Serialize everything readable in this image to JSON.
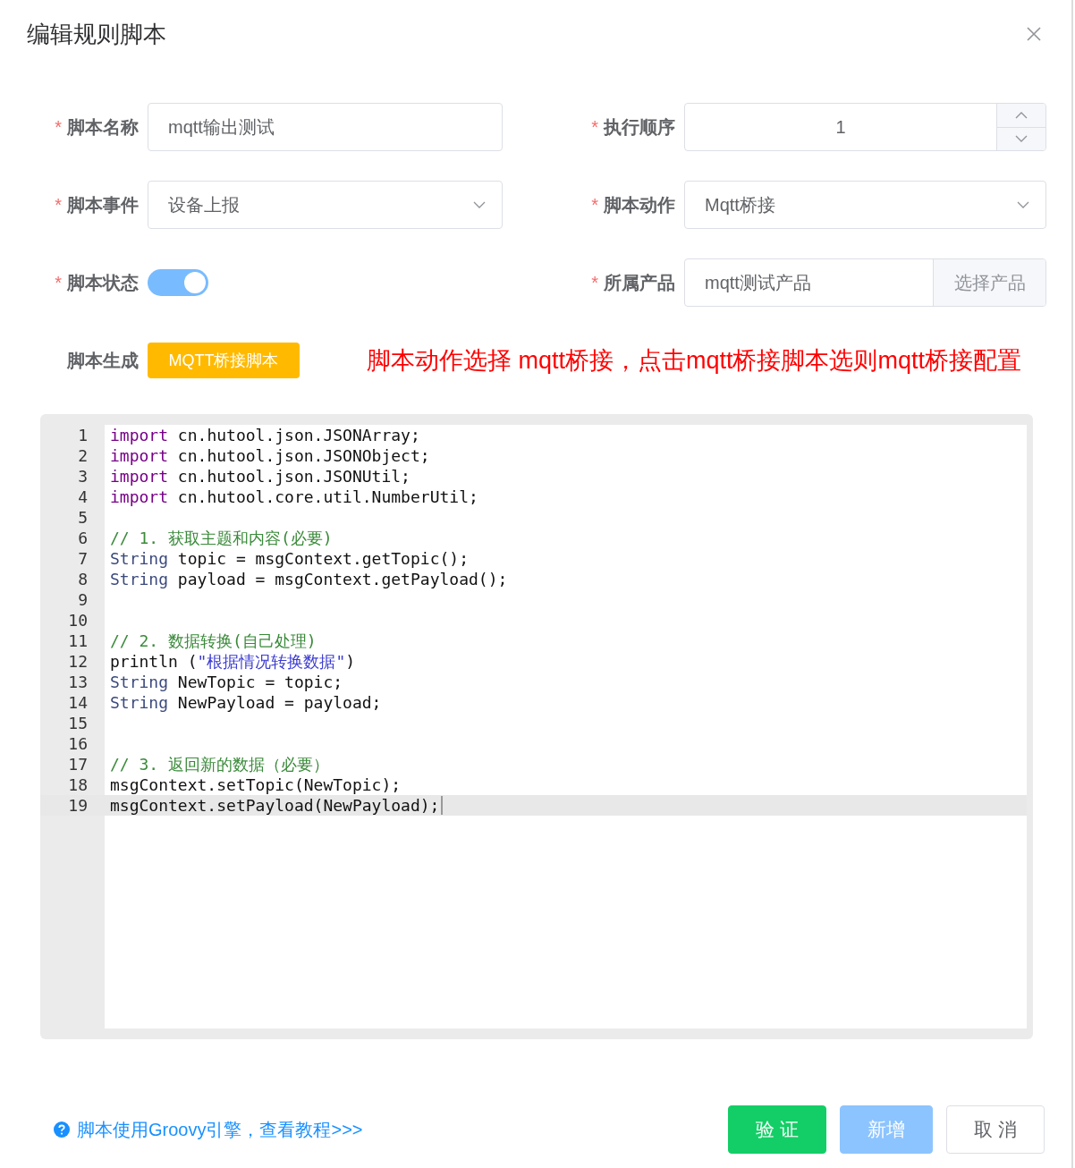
{
  "dialog": {
    "title": "编辑规则脚本"
  },
  "fields": [
    {
      "kind": "text",
      "label": "脚本名称",
      "required_mark": "*",
      "value": "mqtt输出测试"
    },
    {
      "kind": "number",
      "label": "执行顺序",
      "required_mark": "*",
      "value": "1"
    },
    {
      "kind": "select",
      "label": "脚本事件",
      "required_mark": "*",
      "value": "设备上报"
    },
    {
      "kind": "select",
      "label": "脚本动作",
      "required_mark": "*",
      "value": "Mqtt桥接"
    },
    {
      "kind": "switch",
      "label": "脚本状态",
      "required_mark": "*",
      "on": true
    },
    {
      "kind": "picker",
      "label": "所属产品",
      "required_mark": "*",
      "value": "mqtt测试产品",
      "button": "选择产品"
    },
    {
      "kind": "generator",
      "label": "脚本生成",
      "button": "MQTT桥接脚本",
      "note": "脚本动作选择 mqtt桥接，点击mqtt桥接脚本选则mqtt桥接配置"
    }
  ],
  "editor": {
    "lines": [
      {
        "number": "1",
        "active": false,
        "tokens": [
          {
            "kind": "keyword",
            "text": "import"
          },
          {
            "kind": "plain",
            "text": " cn.hutool.json.JSONArray;"
          }
        ]
      },
      {
        "number": "2",
        "active": false,
        "tokens": [
          {
            "kind": "keyword",
            "text": "import"
          },
          {
            "kind": "plain",
            "text": " cn.hutool.json.JSONObject;"
          }
        ]
      },
      {
        "number": "3",
        "active": false,
        "tokens": [
          {
            "kind": "keyword",
            "text": "import"
          },
          {
            "kind": "plain",
            "text": " cn.hutool.json.JSONUtil;"
          }
        ]
      },
      {
        "number": "4",
        "active": false,
        "tokens": [
          {
            "kind": "keyword",
            "text": "import"
          },
          {
            "kind": "plain",
            "text": " cn.hutool.core.util.NumberUtil;"
          }
        ]
      },
      {
        "number": "5",
        "active": false
      },
      {
        "number": "6",
        "active": false,
        "tokens": [
          {
            "kind": "comment",
            "text": "// 1. 获取主题和内容(必要)"
          }
        ]
      },
      {
        "number": "7",
        "active": false,
        "tokens": [
          {
            "kind": "type",
            "text": "String"
          },
          {
            "kind": "plain",
            "text": " topic = msgContext.getTopic();"
          }
        ]
      },
      {
        "number": "8",
        "active": false,
        "tokens": [
          {
            "kind": "type",
            "text": "String"
          },
          {
            "kind": "plain",
            "text": " payload = msgContext.getPayload();"
          }
        ]
      },
      {
        "number": "9",
        "active": false
      },
      {
        "number": "10",
        "active": false
      },
      {
        "number": "11",
        "active": false,
        "tokens": [
          {
            "kind": "comment",
            "text": "// 2. 数据转换(自己处理)"
          }
        ]
      },
      {
        "number": "12",
        "active": false,
        "tokens": [
          {
            "kind": "plain",
            "text": "println ("
          },
          {
            "kind": "string",
            "text": "\"根据情况转换数据\""
          },
          {
            "kind": "plain",
            "text": ")"
          }
        ]
      },
      {
        "number": "13",
        "active": false,
        "tokens": [
          {
            "kind": "type",
            "text": "String"
          },
          {
            "kind": "plain",
            "text": " NewTopic = topic;"
          }
        ]
      },
      {
        "number": "14",
        "active": false,
        "tokens": [
          {
            "kind": "type",
            "text": "String"
          },
          {
            "kind": "plain",
            "text": " NewPayload = payload;"
          }
        ]
      },
      {
        "number": "15",
        "active": false
      },
      {
        "number": "16",
        "active": false
      },
      {
        "number": "17",
        "active": false,
        "tokens": [
          {
            "kind": "comment",
            "text": "// 3. 返回新的数据（必要）"
          }
        ]
      },
      {
        "number": "18",
        "active": false,
        "tokens": [
          {
            "kind": "plain",
            "text": "msgContext.setTopic(NewTopic);"
          }
        ]
      },
      {
        "number": "19",
        "active": true,
        "tokens": [
          {
            "kind": "plain",
            "text": "msgContext.setPayload(NewPayload);"
          }
        ]
      }
    ]
  },
  "footer": {
    "help": "脚本使用Groovy引擎，查看教程>>>",
    "buttons": [
      {
        "label": "验 证",
        "kind": "success",
        "disabled": false
      },
      {
        "label": "新增",
        "kind": "primary",
        "disabled": true
      },
      {
        "label": "取 消",
        "kind": "default",
        "disabled": false
      }
    ]
  }
}
